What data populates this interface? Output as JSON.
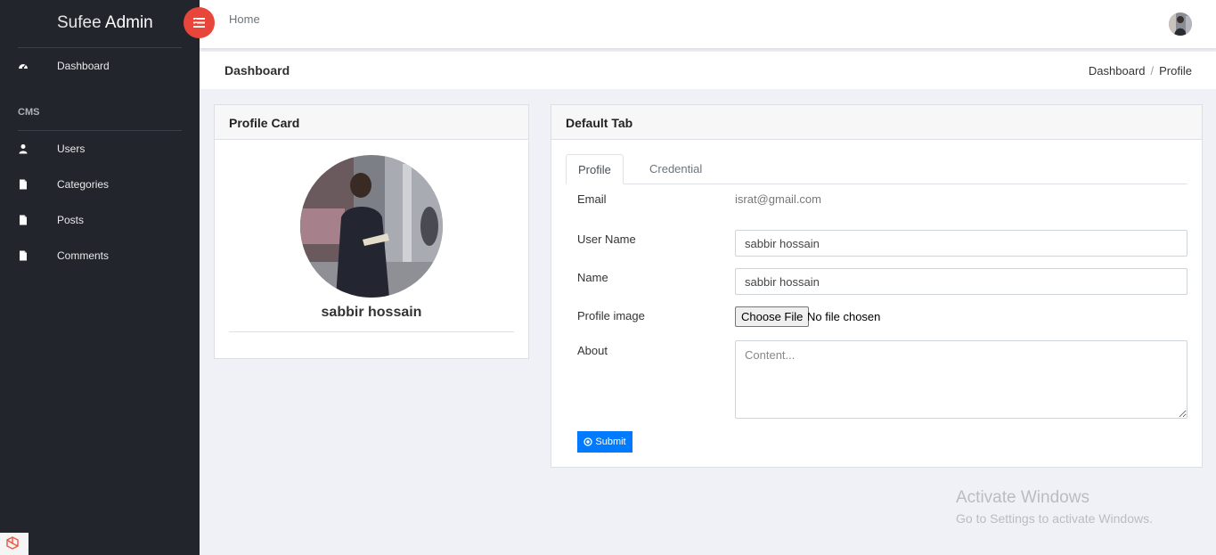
{
  "brand": {
    "light": "Sufee",
    "bold": "Admin"
  },
  "sidebar": {
    "section_label": "CMS",
    "items": [
      {
        "label": "Dashboard",
        "icon": "dashboard-icon"
      },
      {
        "label": "Users",
        "icon": "user-icon"
      },
      {
        "label": "Categories",
        "icon": "file-icon"
      },
      {
        "label": "Posts",
        "icon": "file-icon"
      },
      {
        "label": "Comments",
        "icon": "file-icon"
      }
    ]
  },
  "header": {
    "home_label": "Home",
    "menu_icon": "menu-toggle-icon"
  },
  "titlebar": {
    "title": "Dashboard",
    "breadcrumb": [
      "Dashboard",
      "Profile"
    ],
    "separator": "/"
  },
  "profile_card": {
    "title": "Profile Card",
    "name": "sabbir hossain"
  },
  "tab_card": {
    "title": "Default Tab",
    "tabs": [
      {
        "label": "Profile",
        "active": true
      },
      {
        "label": "Credential",
        "active": false
      }
    ],
    "form": {
      "email_label": "Email",
      "email_value": "israt@gmail.com",
      "username_label": "User Name",
      "username_value": "sabbir hossain",
      "name_label": "Name",
      "name_value": "sabbir hossain",
      "image_label": "Profile image",
      "file_button": "Choose File",
      "file_status": "No file chosen",
      "about_label": "About",
      "about_placeholder": "Content...",
      "submit_label": "Submit"
    }
  },
  "watermark": {
    "title": "Activate Windows",
    "subtitle": "Go to Settings to activate Windows."
  },
  "colors": {
    "sidebar_bg": "#22252c",
    "menu_button": "#e8463a",
    "primary": "#007bff",
    "page_bg": "#f0f1f6"
  }
}
